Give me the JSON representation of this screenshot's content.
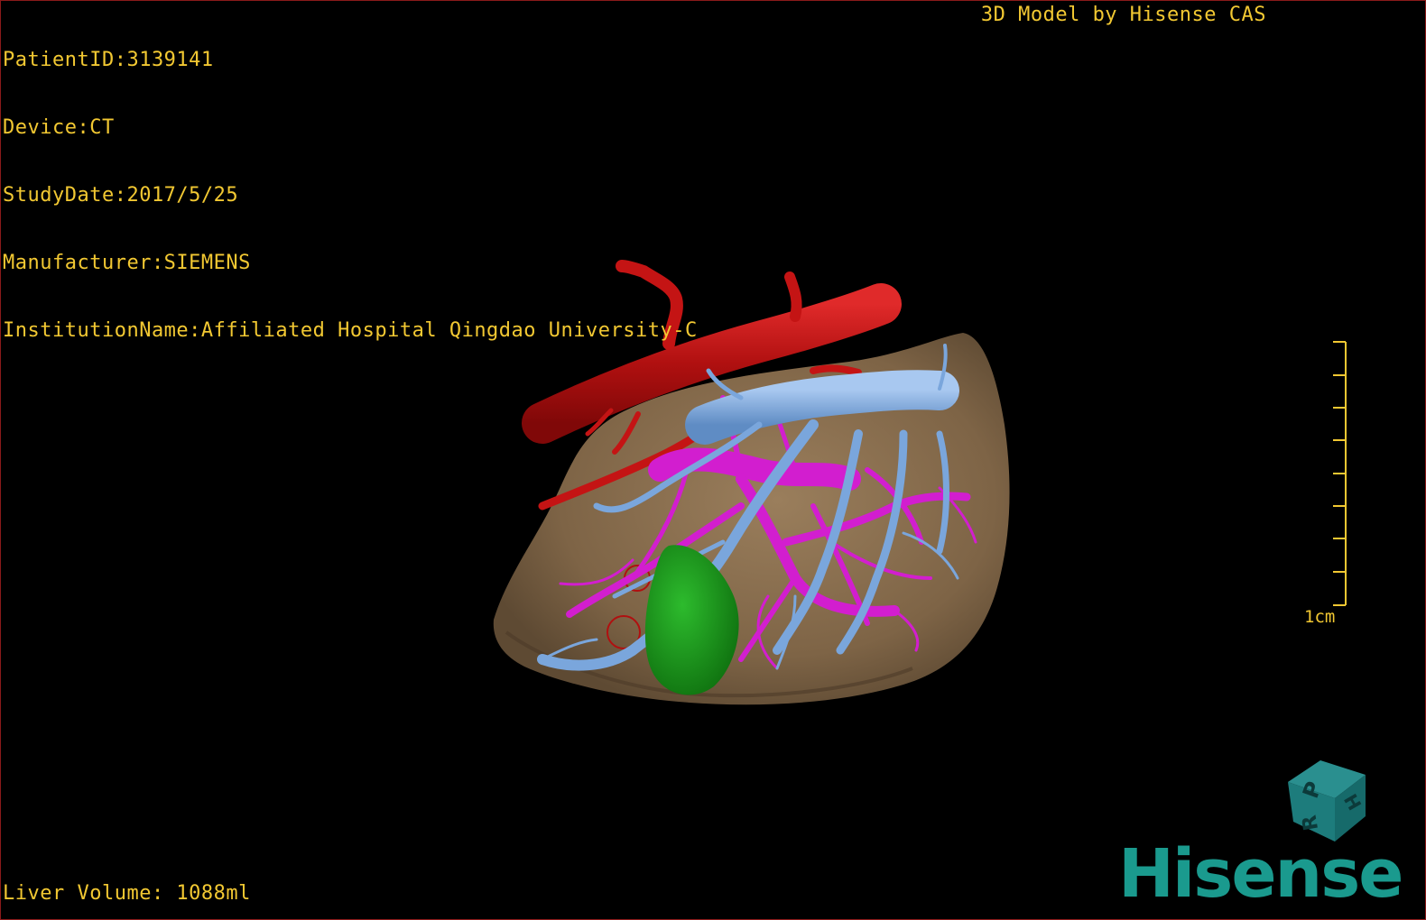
{
  "patient_info": {
    "patient_id": "PatientID:3139141",
    "device": "Device:CT",
    "study_date": "StudyDate:2017/5/25",
    "manufacturer": "Manufacturer:SIEMENS",
    "institution": "InstitutionName:Affiliated Hospital Qingdao University-C"
  },
  "credit": "3D Model by Hisense CAS",
  "liver_volume": "Liver Volume: 1088ml",
  "scale": {
    "label": "1cm"
  },
  "orientation_cube": {
    "labels": [
      "P",
      "H",
      "R"
    ]
  },
  "brand": "Hisense",
  "colors": {
    "overlay_text": "#f2c832",
    "liver": "#8a7050",
    "artery": "#c41414",
    "hepatic_vein": "#7aa6dc",
    "portal_vein": "#d21ecf",
    "tumor": "#1f9e1f",
    "brand": "#1a9a8e"
  }
}
